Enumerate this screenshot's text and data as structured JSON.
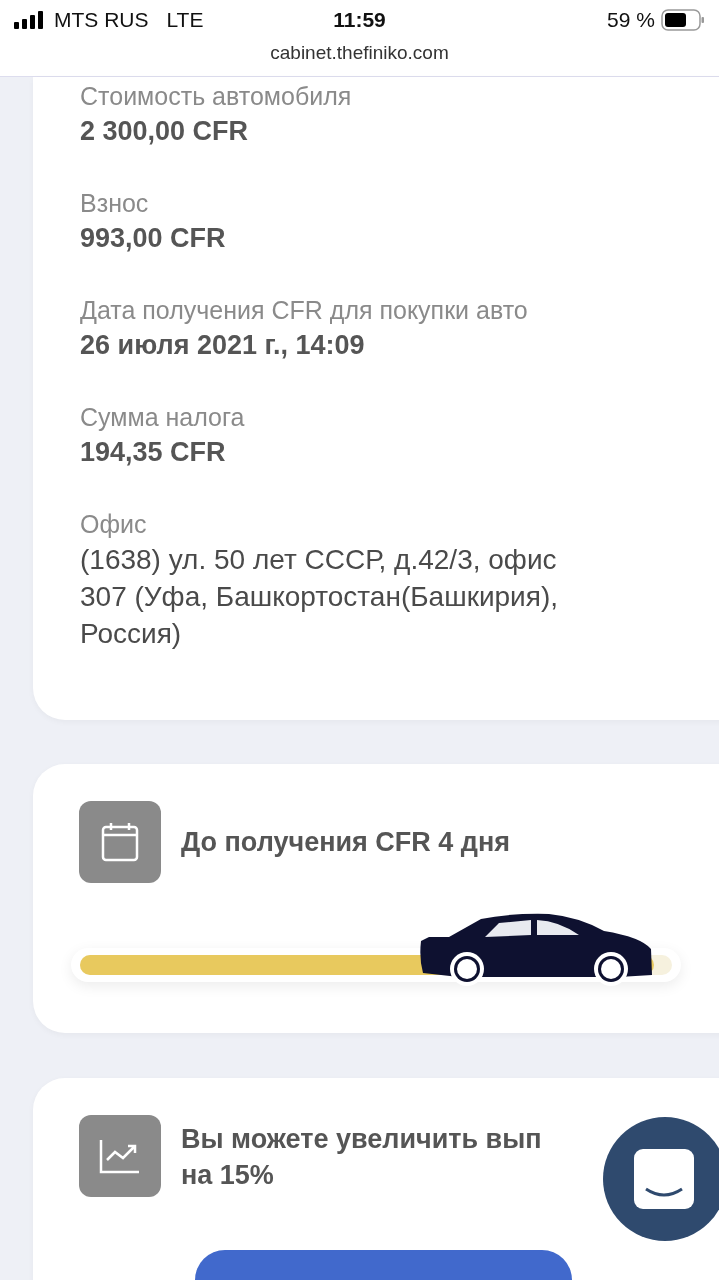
{
  "status_bar": {
    "carrier": "MTS RUS",
    "network": "LTE",
    "time": "11:59",
    "battery": "59 %"
  },
  "address_bar": {
    "url": "cabinet.thefiniko.com"
  },
  "details": [
    {
      "label": "Стоимость автомобиля",
      "value": [
        "2 300,00 CFR"
      ]
    },
    {
      "label": "Взнос",
      "value": [
        "993,00 CFR"
      ]
    },
    {
      "label": "Дата получения CFR для покупки авто",
      "value": [
        "26 июля 2021 г., 14:09"
      ]
    },
    {
      "label": "Сумма налога",
      "value": [
        "194,35 CFR"
      ]
    },
    {
      "label": "Офис",
      "value": [
        "(1638) ул. 50 лет СССР, д.42/3, офис",
        "307 (Уфа, Башкортостан(Башкирия),",
        "Россия)"
      ]
    }
  ],
  "countdown": {
    "title": "До получения CFR 4 дня",
    "level": 0.97
  },
  "promo": {
    "title": [
      "Вы можете увеличить вып",
      "на 15%"
    ]
  }
}
